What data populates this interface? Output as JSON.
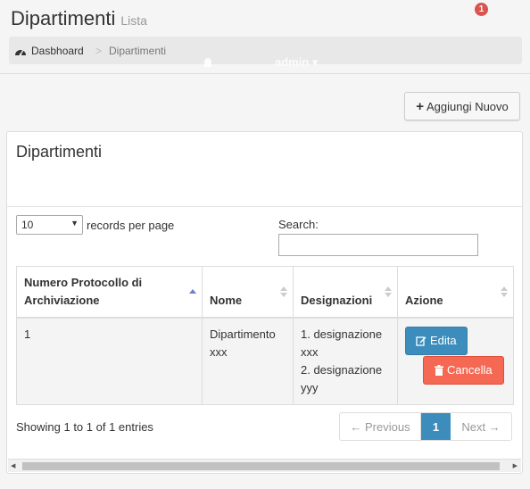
{
  "header": {
    "title": "Dipartimenti",
    "subtitle": "Lista",
    "breadcrumb": {
      "home": "Dasbhoard",
      "separator": ">",
      "current": "Dipartimenti"
    },
    "ghost_nav": {
      "badge": "1",
      "user": "admin"
    }
  },
  "toolbar": {
    "add_label": "Aggiungi Nuovo"
  },
  "panel": {
    "title": "Dipartimenti",
    "length_value": "10",
    "length_label": "records per page",
    "search_label": "Search:"
  },
  "table": {
    "columns": [
      "Numero Protocollo di Archiviazione",
      "Nome",
      "Designazioni",
      "Azione"
    ],
    "rows": [
      {
        "numero": "1",
        "nome": "Dipartimento xxx",
        "designazioni": [
          "1. designazione xxx",
          "2. designazione yyy"
        ]
      }
    ],
    "edit_label": "Edita",
    "delete_label": "Cancella"
  },
  "footer": {
    "info": "Showing 1 to 1 of 1 entries",
    "prev": "← Previous",
    "page": "1",
    "next": "Next →"
  },
  "colors": {
    "primary": "#3c8dbc",
    "danger": "#f56954",
    "badge": "#d9534f",
    "sort_active": "#6d7fcc"
  }
}
